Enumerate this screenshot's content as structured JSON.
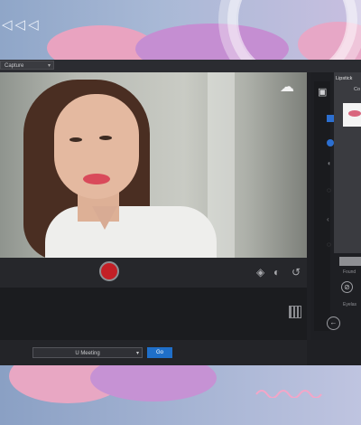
{
  "toolbar": {
    "capture_label": "Capture",
    "capture_icon": "chevron-down-icon"
  },
  "preview": {
    "cloud_icon": "cloud-sync-icon"
  },
  "controls": {
    "record_button": "record-icon",
    "layers_icon": "layers-icon",
    "effects_icon": "effects-icon",
    "reset_icon": "reset-icon",
    "grid_icon": "grid-icon"
  },
  "footer": {
    "meeting_value": "U Meeting",
    "go_label": "Go"
  },
  "panel": {
    "popup_title": "Lipstick",
    "popup_sub": "Co",
    "foundation_label": "Found",
    "eyelash_label": "Eyelas",
    "back_icon": "back-arrow-icon"
  },
  "colors": {
    "accent": "#2c6fd0",
    "record": "#c32026",
    "lipstick": "#d9667e"
  }
}
